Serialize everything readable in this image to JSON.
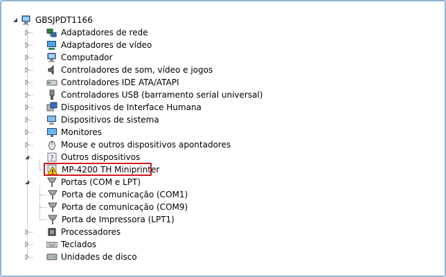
{
  "root": {
    "label": "GBSJPDT1166",
    "icon": "computer-icon",
    "expanded": true
  },
  "categories": [
    {
      "label": "Adaptadores de rede",
      "icon": "network-adapter-icon",
      "expanded": false
    },
    {
      "label": "Adaptadores de vídeo",
      "icon": "display-adapter-icon",
      "expanded": false
    },
    {
      "label": "Computador",
      "icon": "computer-icon",
      "expanded": false
    },
    {
      "label": "Controladores de som, vídeo e jogos",
      "icon": "speaker-icon",
      "expanded": false
    },
    {
      "label": "Controladores IDE ATA/ATAPI",
      "icon": "ide-controller-icon",
      "expanded": false
    },
    {
      "label": "Controladores USB (barramento serial universal)",
      "icon": "usb-icon",
      "expanded": false
    },
    {
      "label": "Dispositivos de Interface Humana",
      "icon": "hid-icon",
      "expanded": false
    },
    {
      "label": "Dispositivos de sistema",
      "icon": "system-device-icon",
      "expanded": false
    },
    {
      "label": "Monitores",
      "icon": "monitor-icon",
      "expanded": false
    },
    {
      "label": "Mouse e outros dispositivos apontadores",
      "icon": "mouse-icon",
      "expanded": false
    },
    {
      "label": "Outros dispositivos",
      "icon": "unknown-device-icon",
      "expanded": true,
      "children": [
        {
          "label": "MP-4200 TH Miniprinter",
          "icon": "warning-device-icon",
          "highlighted": true
        }
      ]
    },
    {
      "label": "Portas (COM e LPT)",
      "icon": "port-icon",
      "expanded": true,
      "children": [
        {
          "label": "Porta de comunicação (COM1)",
          "icon": "port-icon"
        },
        {
          "label": "Porta de comunicação (COM9)",
          "icon": "port-icon"
        },
        {
          "label": "Porta de Impressora (LPT1)",
          "icon": "port-icon"
        }
      ]
    },
    {
      "label": "Processadores",
      "icon": "processor-icon",
      "expanded": false
    },
    {
      "label": "Teclados",
      "icon": "keyboard-icon",
      "expanded": false
    },
    {
      "label": "Unidades de disco",
      "icon": "disk-drive-icon",
      "expanded": false
    }
  ],
  "colors": {
    "highlight_border": "#d0191f",
    "frame_border": "#8fb3d7",
    "warning": "#f5c400"
  }
}
